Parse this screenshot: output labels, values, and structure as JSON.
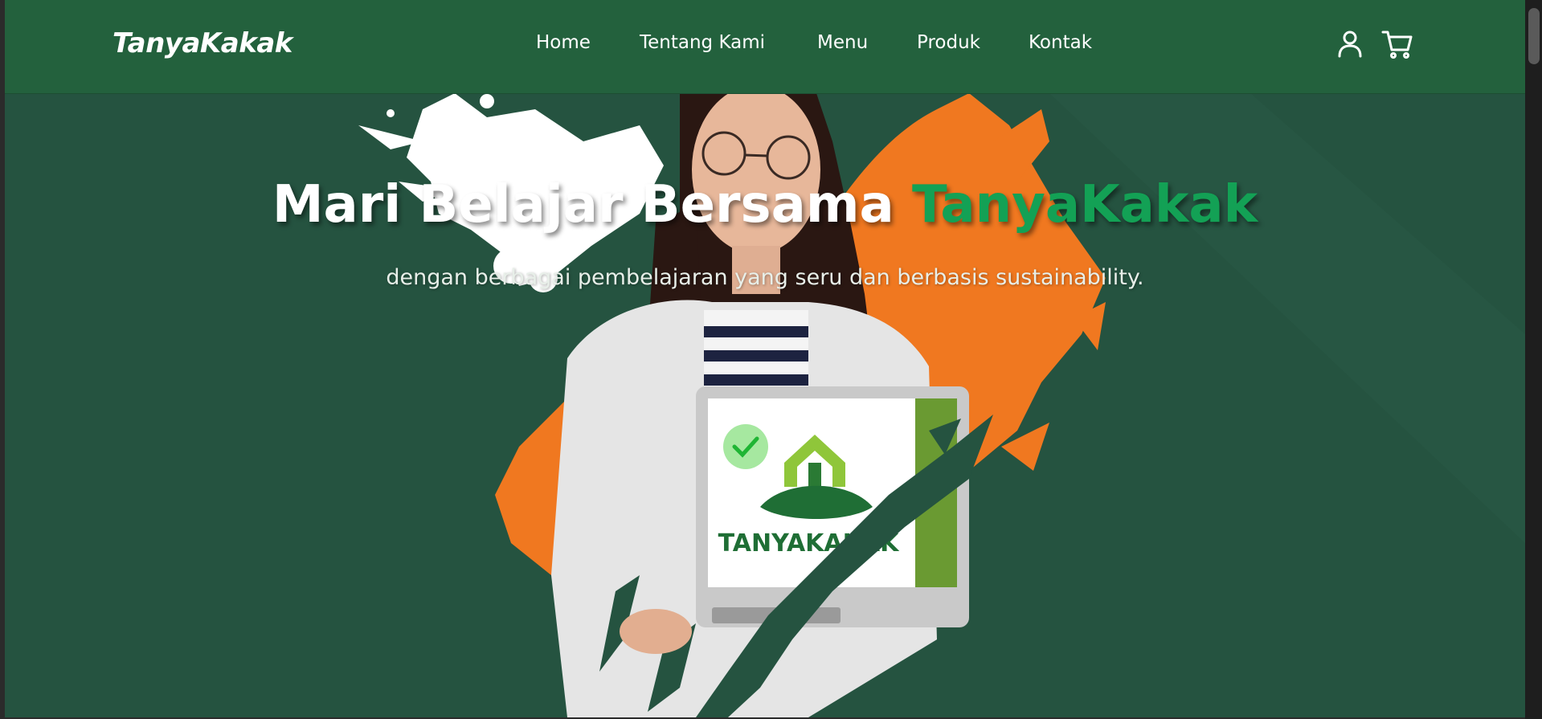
{
  "brand": {
    "name": "TanyaKakak"
  },
  "nav": {
    "items": [
      {
        "label": "Home"
      },
      {
        "label": "Tentang Kami"
      },
      {
        "label": "Menu"
      },
      {
        "label": "Produk"
      },
      {
        "label": "Kontak"
      }
    ],
    "icons": [
      "user-icon",
      "cart-icon"
    ]
  },
  "hero": {
    "title_main": "Mari Belajar Bersama ",
    "title_accent": "TanyaKakak",
    "subtitle": "dengan berbagai pembelajaran yang seru dan berbasis sustainability."
  },
  "laptop_logo": {
    "text": "TANYAKAKAK"
  },
  "colors": {
    "navbar": "#23613d",
    "hero_background": "#255340",
    "accent_green": "#13a155",
    "splash_orange": "#f07820"
  }
}
